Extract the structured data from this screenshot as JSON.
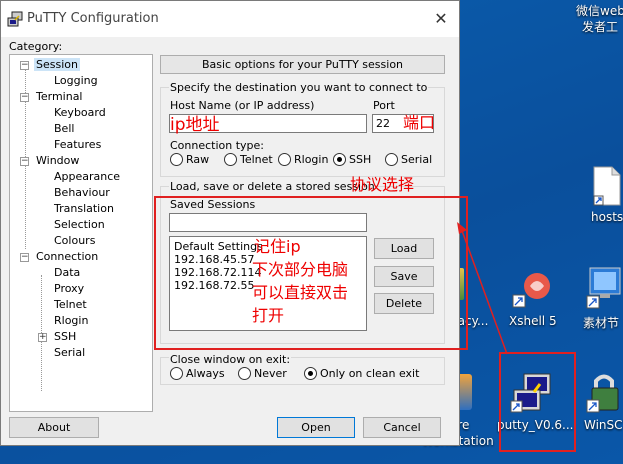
{
  "desktop": {
    "top_right_line1": "微信web",
    "top_right_line2": "发者工",
    "hosts_label": "hosts",
    "xshell_label": "Xshell 5",
    "sucai_label": "素材节",
    "legacy_label": "gacy...",
    "workstation_line1": "are",
    "workstation_line2": "Workstation",
    "putty_label": "putty_V0.6...",
    "winscp_label": "WinSC"
  },
  "window": {
    "title": "PuTTY Configuration",
    "category_label": "Category:",
    "tree": [
      {
        "label": "Session",
        "box": "−"
      },
      {
        "label": "Logging"
      },
      {
        "label": "Terminal",
        "box": "−"
      },
      {
        "label": "Keyboard"
      },
      {
        "label": "Bell"
      },
      {
        "label": "Features"
      },
      {
        "label": "Window",
        "box": "−"
      },
      {
        "label": "Appearance"
      },
      {
        "label": "Behaviour"
      },
      {
        "label": "Translation"
      },
      {
        "label": "Selection"
      },
      {
        "label": "Colours"
      },
      {
        "label": "Connection",
        "box": "−"
      },
      {
        "label": "Data"
      },
      {
        "label": "Proxy"
      },
      {
        "label": "Telnet"
      },
      {
        "label": "Rlogin"
      },
      {
        "label": "SSH",
        "box": "+"
      },
      {
        "label": "Serial"
      }
    ],
    "panel_header": "Basic options for your PuTTY session",
    "dest_group": "Specify the destination you want to connect to",
    "host_label": "Host Name (or IP address)",
    "host_value": "",
    "port_label": "Port",
    "port_value": "22",
    "conn_type_label": "Connection type:",
    "conn_types": [
      "Raw",
      "Telnet",
      "Rlogin",
      "SSH",
      "Serial"
    ],
    "conn_selected": "SSH",
    "sessions_group": "Load, save or delete a stored session",
    "saved_sessions_label": "Saved Sessions",
    "saved_session_value": "",
    "sessions": [
      "Default Settings",
      "192.168.45.57",
      "192.168.72.114",
      "192.168.72.55"
    ],
    "load_btn": "Load",
    "save_btn": "Save",
    "delete_btn": "Delete",
    "close_exit_label": "Close window on exit:",
    "close_options": [
      "Always",
      "Never",
      "Only on clean exit"
    ],
    "close_selected": "Only on clean exit",
    "about_btn": "About",
    "open_btn": "Open",
    "cancel_btn": "Cancel"
  },
  "annotations": {
    "ip": "ip地址",
    "port": "端口",
    "protocol": "协议选择",
    "remember_line1": "记住ip",
    "remember_line2": "下次部分电脑",
    "remember_line3": "可以直接双击",
    "remember_line4": "打开"
  }
}
